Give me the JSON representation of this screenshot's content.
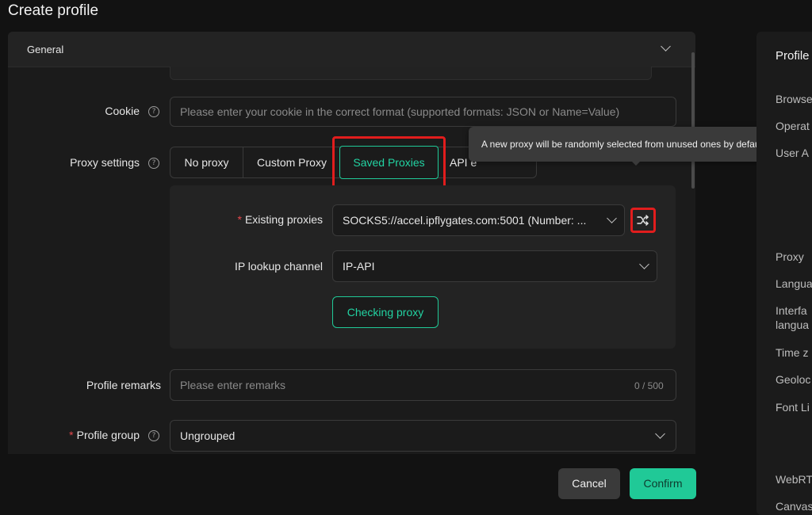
{
  "page": {
    "title": "Create profile"
  },
  "section": {
    "title": "General"
  },
  "cookie": {
    "label": "Cookie",
    "placeholder": "Please enter your cookie in the correct format (supported formats: JSON or Name=Value)"
  },
  "proxy": {
    "label": "Proxy settings",
    "tabs": [
      "No proxy",
      "Custom Proxy",
      "Saved Proxies",
      "API e"
    ],
    "active_tab": "Saved Proxies",
    "tooltip": "A new proxy will be randomly selected from unused ones by default.",
    "existing": {
      "label": "Existing proxies",
      "value": "SOCKS5://accel.ipflygates.com:5001 (Number: ..."
    },
    "ip_lookup": {
      "label": "IP lookup channel",
      "value": "IP-API"
    },
    "check_button": "Checking proxy"
  },
  "remarks": {
    "label": "Profile remarks",
    "placeholder": "Please enter remarks",
    "counter": "0 / 500"
  },
  "group": {
    "label": "Profile group",
    "value": "Ungrouped"
  },
  "footer": {
    "cancel": "Cancel",
    "confirm": "Confirm"
  },
  "right_panel": {
    "title": "Profile",
    "items": [
      "Browse",
      "Operat",
      "User A",
      "Proxy",
      "Langua",
      "Interfa",
      "langua",
      "Time z",
      "Geoloc",
      "Font Li",
      "WebRT",
      "Canvas"
    ]
  },
  "colors": {
    "accent": "#20c997",
    "highlight": "#e11d1d",
    "background": "#121212"
  },
  "icons": {
    "shuffle": "shuffle-icon",
    "help": "question-circle-icon",
    "chevron": "chevron-down-icon"
  }
}
